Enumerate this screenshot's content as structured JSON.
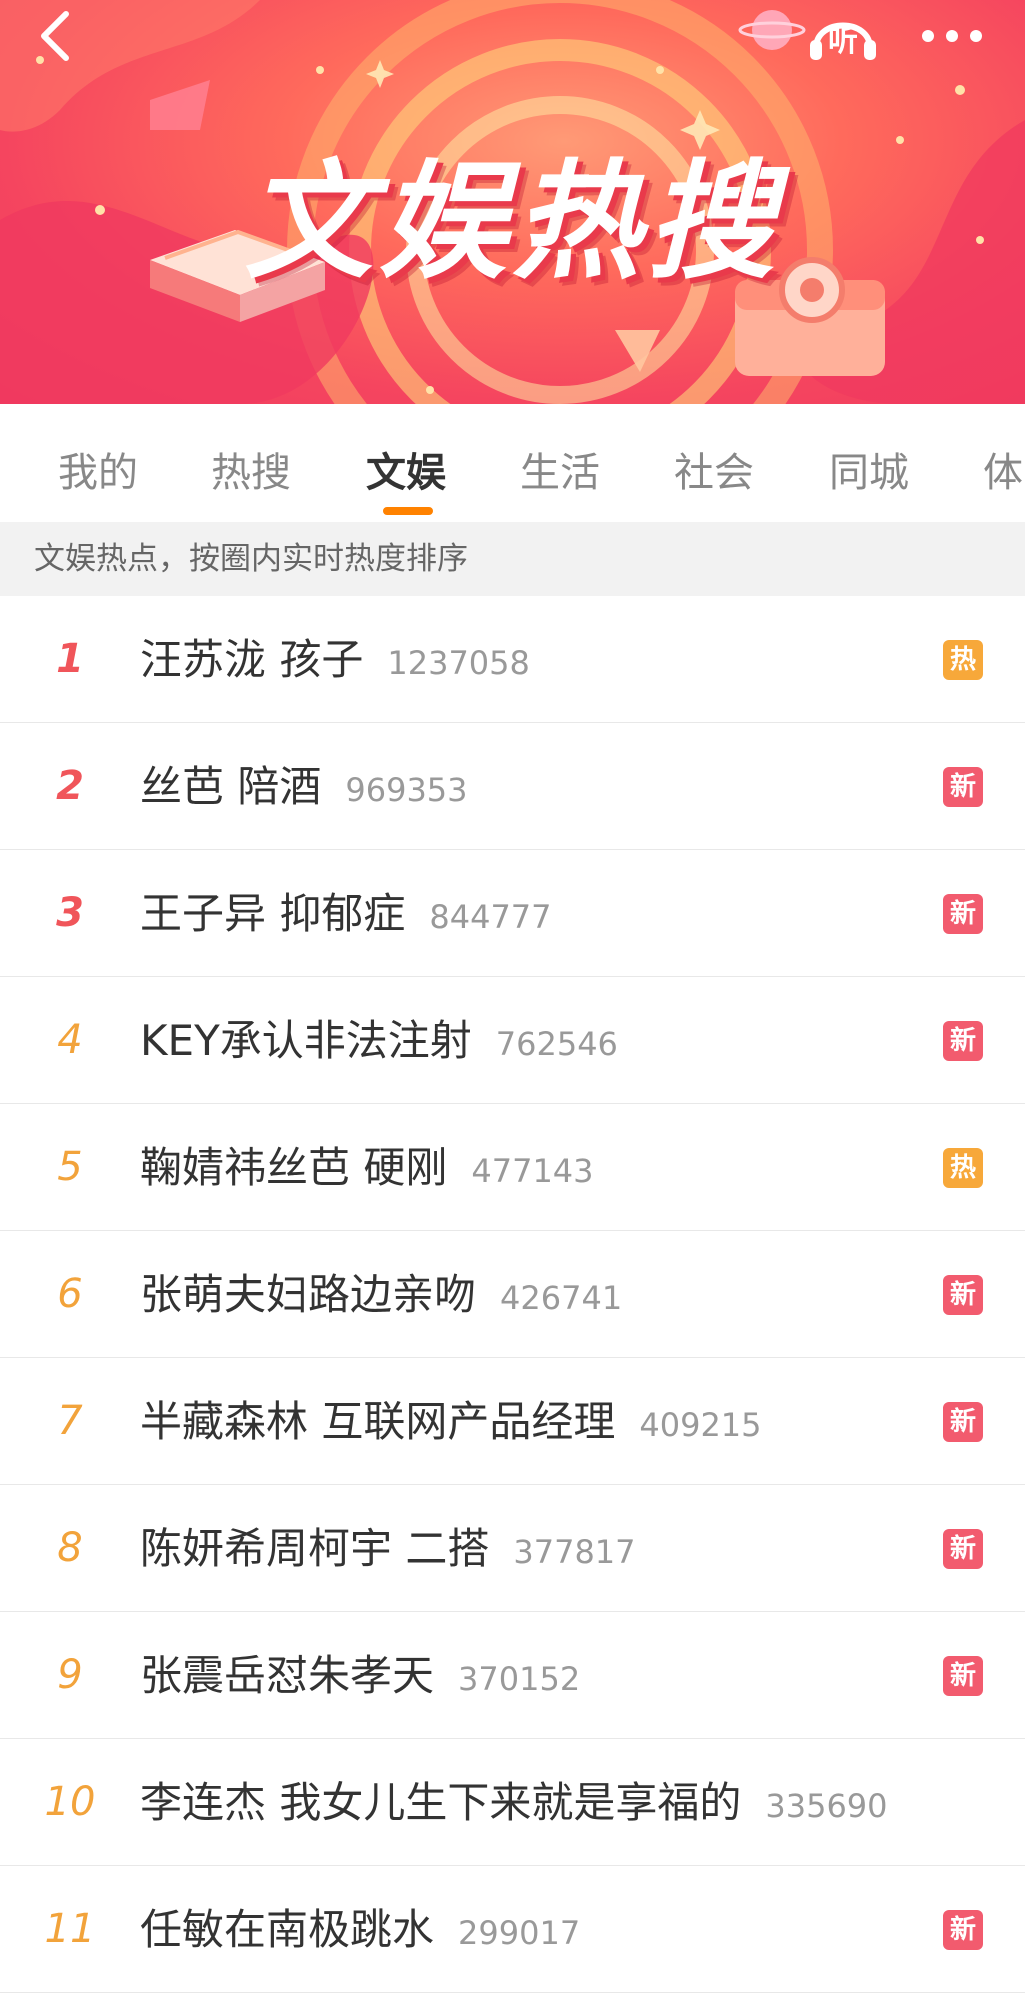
{
  "header": {
    "banner_title": "文娱热搜",
    "listen_label": "听"
  },
  "tabs": [
    {
      "label": "我的"
    },
    {
      "label": "热搜"
    },
    {
      "label": "文娱"
    },
    {
      "label": "生活"
    },
    {
      "label": "社会"
    },
    {
      "label": "同城"
    },
    {
      "label": "体"
    }
  ],
  "active_tab": "文娱",
  "notice": "文娱热点，按圈内实时热度排序",
  "list": [
    {
      "rank": "1",
      "title": "汪苏泷 孩子",
      "count": "1237058",
      "badge": "热"
    },
    {
      "rank": "2",
      "title": "丝芭 陪酒",
      "count": "969353",
      "badge": "新"
    },
    {
      "rank": "3",
      "title": "王子异 抑郁症",
      "count": "844777",
      "badge": "新"
    },
    {
      "rank": "4",
      "title": "KEY承认非法注射",
      "count": "762546",
      "badge": "新"
    },
    {
      "rank": "5",
      "title": "鞠婧祎丝芭 硬刚",
      "count": "477143",
      "badge": "热"
    },
    {
      "rank": "6",
      "title": "张萌夫妇路边亲吻",
      "count": "426741",
      "badge": "新"
    },
    {
      "rank": "7",
      "title": "半藏森林 互联网产品经理",
      "count": "409215",
      "badge": "新"
    },
    {
      "rank": "8",
      "title": "陈妍希周柯宇 二搭",
      "count": "377817",
      "badge": "新"
    },
    {
      "rank": "9",
      "title": "张震岳怼朱孝天",
      "count": "370152",
      "badge": "新"
    },
    {
      "rank": "10",
      "title": "李连杰 我女儿生下来就是享福的",
      "count": "335690",
      "badge": ""
    },
    {
      "rank": "11",
      "title": "任敏在南极跳水",
      "count": "299017",
      "badge": "新"
    }
  ],
  "colors": {
    "accent": "#ff8200",
    "badge_hot": "#f7a83a",
    "badge_new": "#f25b6e",
    "rank_top": "#f0555a",
    "rank_other": "#f2a33b"
  },
  "icons": {
    "back": "chevron-left-icon",
    "listen": "headphones-icon",
    "more": "more-dots-icon"
  }
}
